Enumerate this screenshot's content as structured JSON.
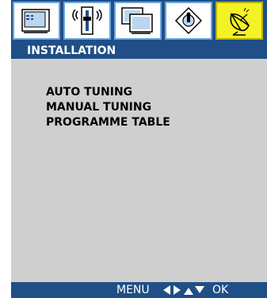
{
  "tabs": [
    {
      "icon": "tv-screen-icon",
      "active": false
    },
    {
      "icon": "audio-control-icon",
      "active": false
    },
    {
      "icon": "multi-screen-icon",
      "active": false
    },
    {
      "icon": "joystick-icon",
      "active": false
    },
    {
      "icon": "satellite-dish-icon",
      "active": true
    }
  ],
  "header": {
    "title": "INSTALLATION"
  },
  "menu": {
    "items": [
      {
        "label": "AUTO TUNING"
      },
      {
        "label": "MANUAL TUNING"
      },
      {
        "label": "PROGRAMME TABLE"
      }
    ]
  },
  "footer": {
    "menu_label": "MENU",
    "nav_icon": "arrows-icon",
    "ok_label": "OK"
  },
  "colors": {
    "bar": "#1f4f86",
    "panel": "#cfcfcf",
    "active_tab": "#f4f224",
    "tab_border": "#6aa6df"
  }
}
